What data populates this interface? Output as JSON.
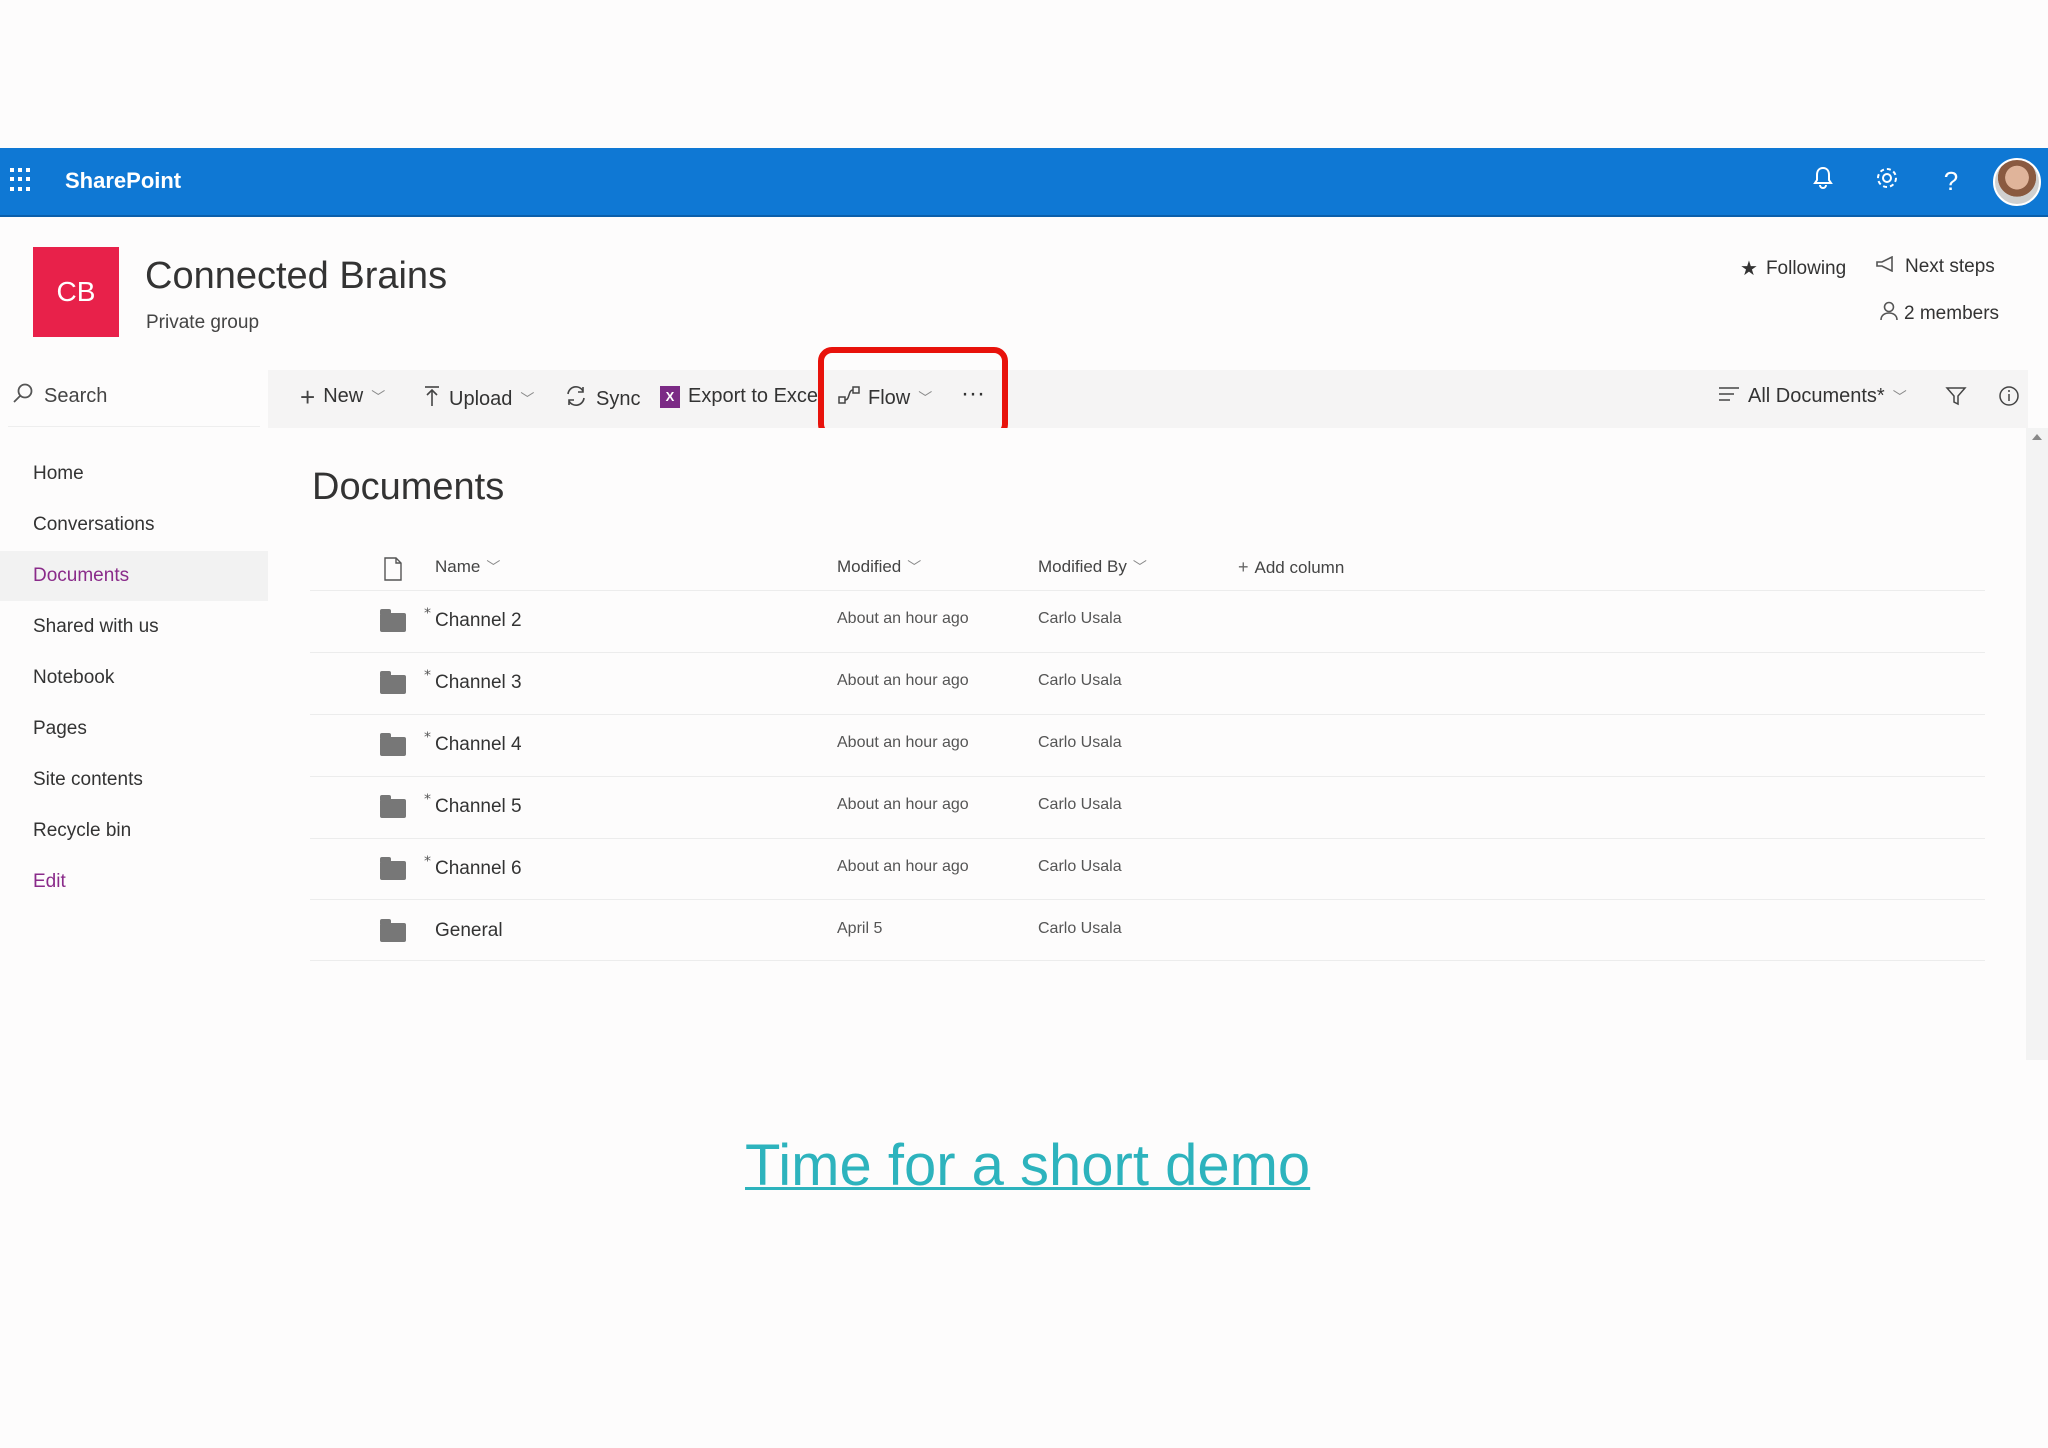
{
  "suitebar": {
    "brand": "SharePoint",
    "icons": [
      "bell-icon",
      "gear-icon",
      "help-icon"
    ]
  },
  "site": {
    "logo": "CB",
    "title": "Connected Brains",
    "subtitle": "Private group",
    "following": "Following",
    "next_steps": "Next steps",
    "members": "2 members"
  },
  "nav": {
    "search": "Search",
    "items": [
      "Home",
      "Conversations",
      "Documents",
      "Shared with us",
      "Notebook",
      "Pages",
      "Site contents",
      "Recycle bin"
    ],
    "edit": "Edit"
  },
  "commands": {
    "new": "New",
    "upload": "Upload",
    "sync": "Sync",
    "export": "Export to Excel",
    "flow": "Flow",
    "more": "···",
    "view": "All Documents*"
  },
  "library": {
    "title": "Documents",
    "columns": {
      "name": "Name",
      "modified": "Modified",
      "modified_by": "Modified By",
      "add": "Add column"
    },
    "rows": [
      {
        "name": "Channel 2",
        "modified": "About an hour ago",
        "by": "Carlo Usala"
      },
      {
        "name": "Channel 3",
        "modified": "About an hour ago",
        "by": "Carlo Usala"
      },
      {
        "name": "Channel 4",
        "modified": "About an hour ago",
        "by": "Carlo Usala"
      },
      {
        "name": "Channel 5",
        "modified": "About an hour ago",
        "by": "Carlo Usala"
      },
      {
        "name": "Channel 6",
        "modified": "About an hour ago",
        "by": "Carlo Usala"
      },
      {
        "name": "General",
        "modified": "April 5",
        "by": "Carlo Usala"
      }
    ]
  },
  "caption": "Time for a short demo",
  "colors": {
    "suitebar": "#0f78d4",
    "logo": "#e8214a",
    "accent": "#8a2b8a",
    "highlight": "#e8120b",
    "caption": "#2db3bd"
  }
}
